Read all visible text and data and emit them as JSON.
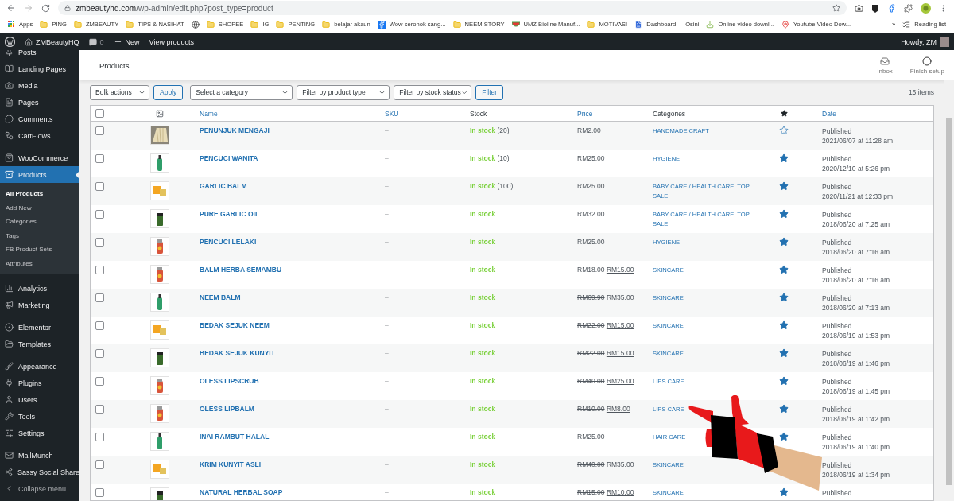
{
  "browser": {
    "url_host": "zmbeautyhq.com",
    "url_path": "/wp-admin/edit.php?post_type=product",
    "bookmarks": [
      {
        "kind": "apps",
        "label": "Apps"
      },
      {
        "kind": "folder",
        "label": "PING"
      },
      {
        "kind": "folder",
        "label": "ZMBEAUTY"
      },
      {
        "kind": "folder",
        "label": "TIPS & NASIHAT"
      },
      {
        "kind": "globe"
      },
      {
        "kind": "folder",
        "label": "SHOPEE"
      },
      {
        "kind": "folder",
        "label": "IG"
      },
      {
        "kind": "folder",
        "label": "PENTING"
      },
      {
        "kind": "folder",
        "label": "belajar akaun"
      },
      {
        "kind": "facebook",
        "label": "Wow seronok sang..."
      },
      {
        "kind": "folder",
        "label": "NEEM STORY"
      },
      {
        "kind": "fruit",
        "label": "UMZ Bioline Manuf..."
      },
      {
        "kind": "folder",
        "label": "MOTIVASI"
      },
      {
        "kind": "doc",
        "label": "Dashboard — Osini"
      },
      {
        "kind": "download",
        "label": "Online video downl..."
      },
      {
        "kind": "pin",
        "label": "Youtube Video Dow..."
      }
    ],
    "more": "»",
    "reading_list": "Reading list"
  },
  "admin_bar": {
    "site": "ZMBeautyHQ",
    "comments": "0",
    "new": "New",
    "view": "View products",
    "greeting": "Howdy, ZM"
  },
  "sidebar": {
    "items": [
      {
        "label": "Posts",
        "selected": false
      },
      {
        "label": "Landing Pages",
        "selected": false
      },
      {
        "label": "Media",
        "selected": false
      },
      {
        "label": "Pages",
        "selected": false
      },
      {
        "label": "Comments",
        "selected": false
      },
      {
        "label": "CartFlows",
        "selected": false
      },
      {
        "label": "WooCommerce",
        "selected": false
      },
      {
        "label": "Products",
        "selected": true,
        "children": [
          {
            "label": "All Products",
            "selected": true
          },
          {
            "label": "Add New",
            "selected": false
          },
          {
            "label": "Categories",
            "selected": false
          },
          {
            "label": "Tags",
            "selected": false
          },
          {
            "label": "FB Product Sets",
            "selected": false
          },
          {
            "label": "Attributes",
            "selected": false
          }
        ]
      },
      {
        "label": "Analytics",
        "selected": false
      },
      {
        "label": "Marketing",
        "selected": false
      },
      {
        "label": "Elementor",
        "selected": false
      },
      {
        "label": "Templates",
        "selected": false
      },
      {
        "label": "Appearance",
        "selected": false
      },
      {
        "label": "Plugins",
        "selected": false
      },
      {
        "label": "Users",
        "selected": false
      },
      {
        "label": "Tools",
        "selected": false
      },
      {
        "label": "Settings",
        "selected": false
      },
      {
        "label": "MailMunch",
        "selected": false
      },
      {
        "label": "Sassy Social Share",
        "selected": false
      },
      {
        "label": "Collapse menu",
        "selected": false
      }
    ]
  },
  "header": {
    "title": "Products",
    "actions": [
      "Inbox",
      "Finish setup"
    ]
  },
  "toolbar": {
    "bulk": "Bulk actions",
    "apply": "Apply",
    "filters": [
      "Select a category",
      "Filter by product type",
      "Filter by stock status"
    ],
    "filter": "Filter",
    "count": "15 items"
  },
  "table": {
    "select_all_checked": false,
    "columns": [
      "Name",
      "SKU",
      "Stock",
      "Price",
      "Categories",
      "Date"
    ],
    "rows": [
      {
        "checked": false,
        "name": "PENUNJUK MENGAJI",
        "sku": "–",
        "stock": "In stock",
        "qty": "(20)",
        "price": "RM2.00",
        "categories": "HANDMADE CRAFT",
        "featured": false,
        "status": "Published",
        "date": "2021/06/07 at 11:28 am"
      },
      {
        "checked": false,
        "name": "PENCUCI WANITA",
        "sku": "–",
        "stock": "In stock",
        "qty": "(10)",
        "price": "RM25.00",
        "categories": "HYGIENE",
        "featured": true,
        "status": "Published",
        "date": "2020/12/10 at 5:26 pm"
      },
      {
        "checked": false,
        "name": "GARLIC BALM",
        "sku": "–",
        "stock": "In stock",
        "qty": "(100)",
        "price": "RM25.00",
        "categories": "BABY CARE / HEALTH CARE, TOP SALE",
        "featured": true,
        "status": "Published",
        "date": "2020/11/21 at 12:33 pm"
      },
      {
        "checked": false,
        "name": "PURE GARLIC OIL",
        "sku": "–",
        "stock": "In stock",
        "price": "RM32.00",
        "categories": "BABY CARE / HEALTH CARE, TOP SALE",
        "featured": true,
        "status": "Published",
        "date": "2018/06/20 at 7:25 am"
      },
      {
        "checked": false,
        "name": "PENCUCI LELAKI",
        "sku": "–",
        "stock": "In stock",
        "price": "RM25.00",
        "categories": "HYGIENE",
        "featured": true,
        "status": "Published",
        "date": "2018/06/20 at 7:16 am"
      },
      {
        "checked": false,
        "name": "BALM HERBA SEMAMBU",
        "sku": "–",
        "stock": "In stock",
        "regular_price": "RM18.00",
        "sale_price": "RM15.00",
        "categories": "SKINCARE",
        "featured": true,
        "status": "Published",
        "date": "2018/06/20 at 7:16 am"
      },
      {
        "checked": false,
        "name": "NEEM BALM",
        "sku": "–",
        "stock": "In stock",
        "regular_price": "RM69.90",
        "sale_price": "RM35.00",
        "categories": "SKINCARE",
        "featured": true,
        "status": "Published",
        "date": "2018/06/20 at 7:13 am"
      },
      {
        "checked": false,
        "name": "BEDAK SEJUK NEEM",
        "sku": "–",
        "stock": "In stock",
        "regular_price": "RM22.00",
        "sale_price": "RM15.00",
        "categories": "SKINCARE",
        "featured": true,
        "status": "Published",
        "date": "2018/06/19 at 1:53 pm"
      },
      {
        "checked": false,
        "name": "BEDAK SEJUK KUNYIT",
        "sku": "–",
        "stock": "In stock",
        "regular_price": "RM22.00",
        "sale_price": "RM15.00",
        "categories": "SKINCARE",
        "featured": true,
        "status": "Published",
        "date": "2018/06/19 at 1:46 pm"
      },
      {
        "checked": false,
        "name": "OLESS LIPSCRUB",
        "sku": "–",
        "stock": "In stock",
        "regular_price": "RM40.00",
        "sale_price": "RM25.00",
        "categories": "LIPS CARE",
        "featured": true,
        "status": "Published",
        "date": "2018/06/19 at 1:45 pm"
      },
      {
        "checked": false,
        "name": "OLESS LIPBALM",
        "sku": "–",
        "stock": "In stock",
        "regular_price": "RM10.00",
        "sale_price": "RM8.00",
        "categories": "LIPS CARE",
        "featured": true,
        "status": "Published",
        "date": "2018/06/19 at 1:42 pm"
      },
      {
        "checked": false,
        "name": "INAI RAMBUT HALAL",
        "sku": "–",
        "stock": "In stock",
        "price": "RM25.00",
        "categories": "HAIR CARE",
        "featured": true,
        "status": "Published",
        "date": "2018/06/19 at 1:40 pm"
      },
      {
        "checked": false,
        "name": "KRIM KUNYIT ASLI",
        "sku": "–",
        "stock": "In stock",
        "regular_price": "RM40.00",
        "sale_price": "RM35.00",
        "categories": "SKINCARE",
        "status": "Published",
        "date": "2018/06/19 at 1:34 pm"
      },
      {
        "checked": false,
        "name": "NATURAL HERBAL SOAP",
        "sku": "–",
        "stock": "In stock",
        "regular_price": "RM15.00",
        "sale_price": "RM10.00",
        "categories": "SKINCARE",
        "featured": true,
        "status": "Published"
      }
    ]
  }
}
